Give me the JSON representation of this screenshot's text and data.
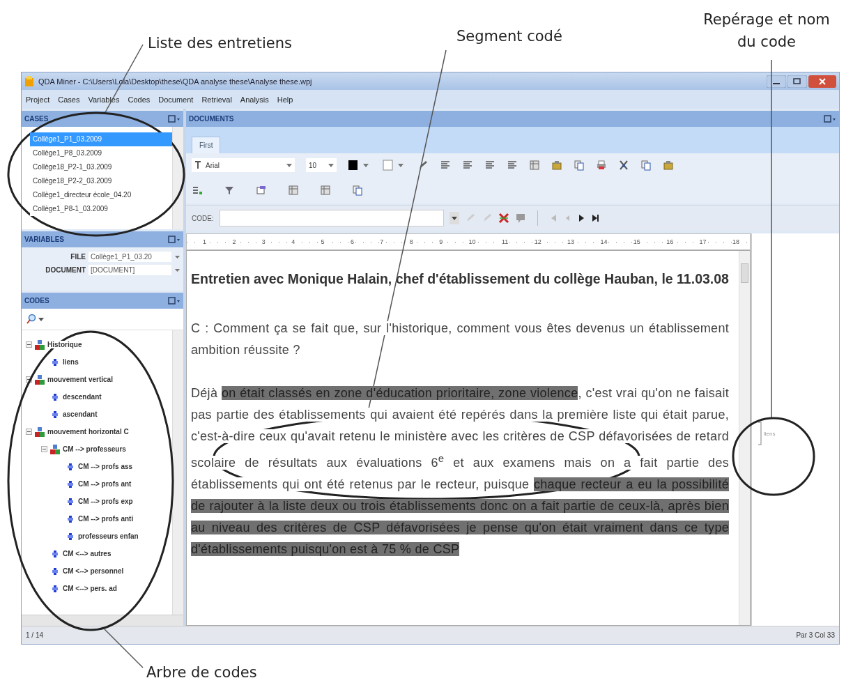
{
  "annotations": [
    {
      "kind": "list",
      "label": "Liste des entretiens"
    },
    {
      "kind": "segment",
      "label": "Segment codé"
    },
    {
      "kind": "mark",
      "label": "Repérage et nom du code"
    },
    {
      "kind": "tree",
      "label": "Arbre de codes"
    }
  ],
  "window": {
    "title": "QDA Miner - C:\\Users\\Lola\\Desktop\\these\\QDA analyse these\\Analyse these.wpj",
    "menu": [
      "Project",
      "Cases",
      "Variables",
      "Codes",
      "Document",
      "Retrieval",
      "Analysis",
      "Help"
    ]
  },
  "cases": {
    "title": "CASES",
    "items": [
      {
        "label": "Collège1_P1_03.2009",
        "selected": true
      },
      {
        "label": "Collège1_P8_03.2009",
        "selected": false
      },
      {
        "label": "Collège18_P2-1_03.2009",
        "selected": false
      },
      {
        "label": "Collège18_P2-2_03.2009",
        "selected": false
      },
      {
        "label": "Collège1_directeur école_04.20",
        "selected": false
      },
      {
        "label": "Collège1_P8-1_03.2009",
        "selected": false
      }
    ]
  },
  "variables": {
    "title": "VARIABLES",
    "rows": [
      {
        "name": "FILE",
        "value": "Collège1_P1_03.20"
      },
      {
        "name": "DOCUMENT",
        "value": "[DOCUMENT]"
      }
    ]
  },
  "codes": {
    "title": "CODES",
    "tree": [
      {
        "label": "Historique",
        "kind": "category",
        "expanded": true,
        "children": [
          {
            "label": "liens",
            "kind": "code"
          }
        ]
      },
      {
        "label": "mouvement vertical",
        "kind": "category",
        "expanded": true,
        "children": [
          {
            "label": "descendant",
            "kind": "code"
          },
          {
            "label": "ascendant",
            "kind": "code"
          }
        ]
      },
      {
        "label": "mouvement horizontal C",
        "kind": "category",
        "expanded": true,
        "children": [
          {
            "label": "CM --> professeurs",
            "kind": "category",
            "expanded": true,
            "children": [
              {
                "label": "CM --> profs ass",
                "kind": "code"
              },
              {
                "label": "CM --> profs ant",
                "kind": "code"
              },
              {
                "label": "CM --> profs exp",
                "kind": "code"
              },
              {
                "label": "CM --> profs anti",
                "kind": "code"
              },
              {
                "label": "professeurs enfan",
                "kind": "code"
              }
            ]
          },
          {
            "label": "CM <--> autres",
            "kind": "code"
          },
          {
            "label": "CM <--> personnel",
            "kind": "code"
          },
          {
            "label": "CM <--> pers. ad",
            "kind": "code"
          }
        ]
      }
    ]
  },
  "documents": {
    "panel_title": "DOCUMENTS",
    "tabs": [
      {
        "label": "First",
        "selected": true
      }
    ],
    "font": "Arial",
    "size": "10",
    "code_label": "CODE:",
    "ruler": [
      "1",
      "2",
      "3",
      "4",
      "5",
      "6",
      "7",
      "8",
      "9",
      "10",
      "11",
      "12",
      "13",
      "14",
      "15",
      "16",
      "17",
      "18"
    ],
    "heading": "Entretien avec Monique Halain, chef d'établissement du collège Hauban, le 11.03.08",
    "paragraphs": [
      {
        "segments": [
          {
            "text": "C : Comment ça se fait que, sur l'historique, comment vous êtes devenus un établissement ambition réussite ?",
            "coded": false
          }
        ]
      },
      {
        "segments": [
          {
            "text": "Déjà ",
            "coded": false
          },
          {
            "text": "on était classés en zone d'éducation prioritaire, zone violence",
            "coded": true
          },
          {
            "text": ", c'est vrai qu'on ne faisait pas partie des établissements qui avaient été repérés dans la première liste qui était parue, c'est-à-dire ceux qu'avait retenu le ministère avec les critères de CSP défavorisées de retard scolaire de résultats aux évaluations 6$^{e}$ et aux examens mais on a fait partie des établissements qui ont été retenus par le recteur, puisque ",
            "coded": false
          },
          {
            "text": "chaque recteur a eu la possibilité de rajouter à la liste deux ou trois établissements donc on a fait partie de ceux-là, après bien au niveau des critères de CSP défavorisées je pense qu'on était vraiment dans ce type d'établissements puisqu'on est à 75 % de CSP",
            "coded": true
          }
        ]
      }
    ],
    "margin_code": "liens"
  },
  "status_bar": {
    "left": "1 / 14",
    "right": "Par 3 Col 33"
  }
}
